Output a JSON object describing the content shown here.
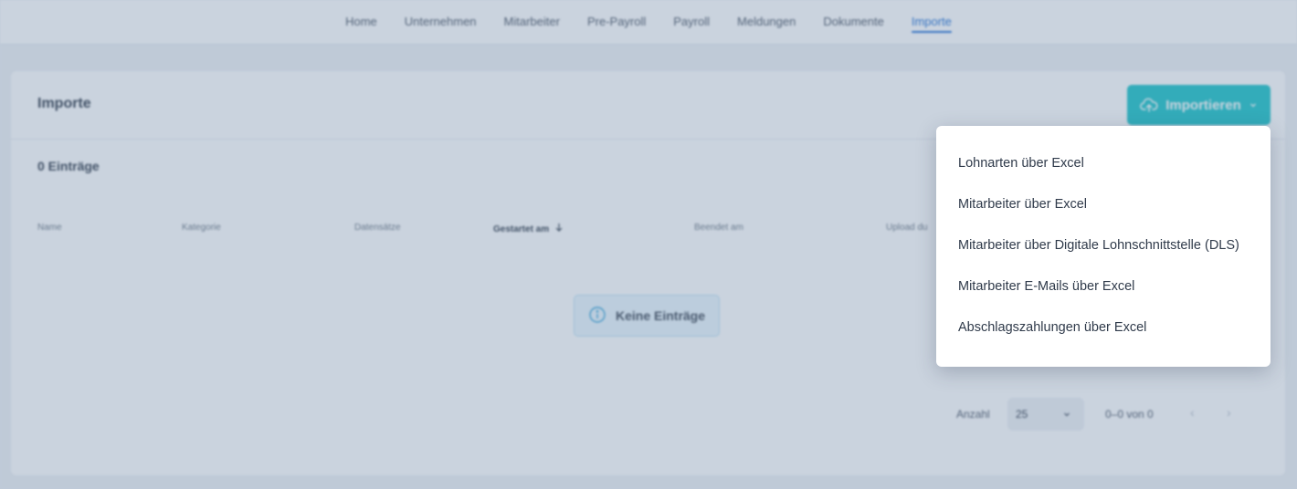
{
  "nav": {
    "items": [
      {
        "label": "Home"
      },
      {
        "label": "Unternehmen"
      },
      {
        "label": "Mitarbeiter"
      },
      {
        "label": "Pre-Payroll"
      },
      {
        "label": "Payroll"
      },
      {
        "label": "Meldungen"
      },
      {
        "label": "Dokumente"
      },
      {
        "label": "Importe"
      }
    ],
    "active": "Importe"
  },
  "card": {
    "title": "Importe",
    "import_button_label": "Importieren",
    "entry_count": "0 Einträge",
    "columns": [
      "Name",
      "Kategorie",
      "Datensätze",
      "Gestartet am",
      "Beendet am",
      "Upload du"
    ],
    "empty_message": "Keine Einträge"
  },
  "pager": {
    "label": "Anzahl",
    "page_size": "25",
    "range": "0–0 von 0"
  },
  "menu": {
    "items": [
      {
        "label": "Lohnarten über Excel"
      },
      {
        "label": "Mitarbeiter über Excel"
      },
      {
        "label": "Mitarbeiter über Digitale Lohnschnittstelle (DLS)"
      },
      {
        "label": "Mitarbeiter E-Mails über Excel"
      },
      {
        "label": "Abschlagszahlungen über Excel"
      }
    ]
  },
  "colors": {
    "accent": "#18c3c8",
    "nav_active": "#1f6fd6",
    "overlay": "#6780a0"
  },
  "icons": {
    "import_button": "cloud-upload-icon",
    "import_dropdown": "chevron-down-icon",
    "sort": "arrow-down-icon",
    "empty_state": "info-icon",
    "pager_select": "chevron-down-icon",
    "pager_prev": "chevron-left-icon",
    "pager_next": "chevron-right-icon"
  }
}
